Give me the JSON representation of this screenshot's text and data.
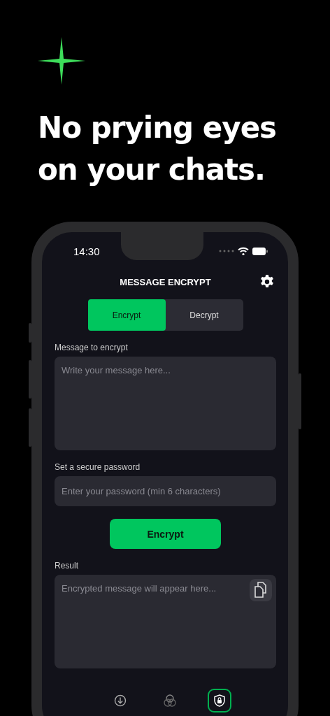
{
  "headline": [
    "No prying eyes",
    "on your chats."
  ],
  "status_bar": {
    "time": "14:30"
  },
  "header": {
    "title": "MESSAGE ENCRYPT"
  },
  "mode_tabs": [
    {
      "label": "Encrypt",
      "selected": true
    },
    {
      "label": "Decrypt",
      "selected": false
    }
  ],
  "message": {
    "label": "Message to encrypt",
    "placeholder": "Write your message here..."
  },
  "password": {
    "label": "Set a secure password",
    "placeholder": "Enter your password (min 6 characters)"
  },
  "action_button": {
    "label": "Encrypt"
  },
  "result": {
    "label": "Result",
    "placeholder": "Encrypted message will appear here..."
  },
  "tab_bar": [
    {
      "kind": "download",
      "selected": false
    },
    {
      "kind": "circles",
      "selected": false
    },
    {
      "kind": "shield",
      "selected": true
    }
  ]
}
